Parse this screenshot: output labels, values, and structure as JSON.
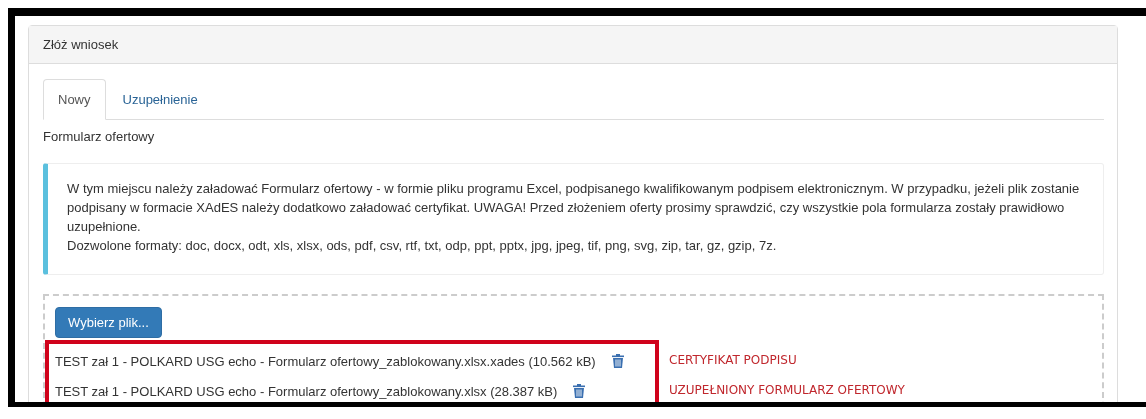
{
  "panel": {
    "title": "Złóż wniosek"
  },
  "tabs": [
    {
      "label": "Nowy",
      "selected": true
    },
    {
      "label": "Uzupełnienie",
      "selected": false
    }
  ],
  "section_title": "Formularz ofertowy",
  "info": {
    "paragraph": "W tym miejscu należy załadować Formularz ofertowy - w formie pliku programu Excel, podpisanego kwalifikowanym podpisem elektronicznym. W przypadku, jeżeli plik zostanie podpisany w formacie XAdES należy dodatkowo załadować certyfikat. UWAGA! Przed złożeniem oferty prosimy sprawdzić, czy wszystkie pola formularza zostały prawidłowo uzupełnione.",
    "formats": "Dozwolone formaty: doc, docx, odt, xls, xlsx, ods, pdf, csv, rtf, txt, odp, ppt, pptx, jpg, jpeg, tif, png, svg, zip, tar, gz, gzip, 7z."
  },
  "upload": {
    "button": "Wybierz plik...",
    "files": [
      {
        "name": "TEST zał 1 - POLKARD USG echo - Formularz ofertowy_zablokowany.xlsx.xades (10.562 kB)",
        "annotation": "CERTYFIKAT PODPISU"
      },
      {
        "name": "TEST zał 1 - POLKARD USG echo - Formularz ofertowy_zablokowany.xlsx (28.387 kB)",
        "annotation": "UZUPEŁNIONY FORMULARZ OFERTOWY"
      }
    ]
  }
}
